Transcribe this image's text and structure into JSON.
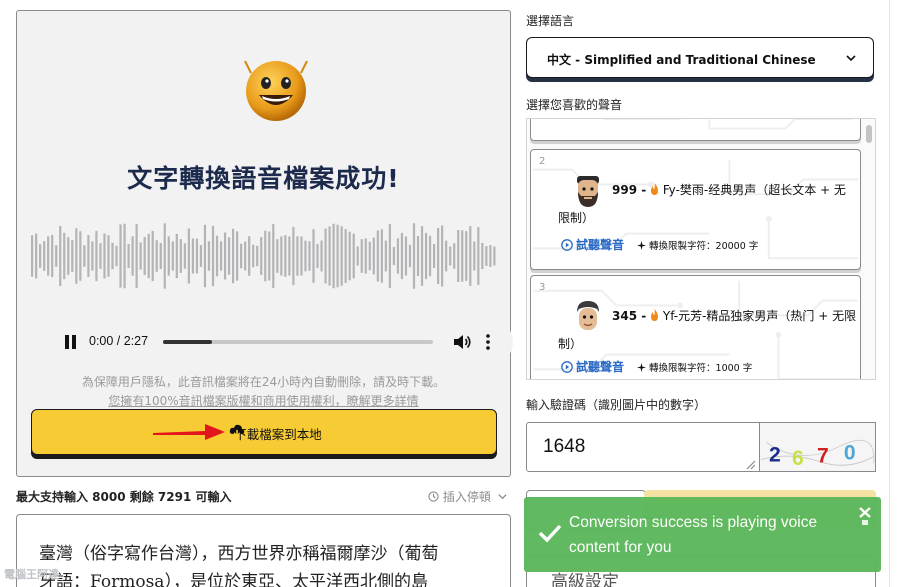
{
  "result": {
    "title": "文字轉換語音檔案成功!",
    "player": {
      "time": "0:00 / 2:27",
      "progress_fraction": 0.18
    },
    "privacy_line1": "為保障用戶隱私，此音訊檔案將在24小時內自動刪除，請及時下載。",
    "privacy_line2": "您擁有100%音訊檔案版權和商用使用權利，瞭解更多詳情",
    "download_label": "下載檔案到本地",
    "accent_color": "#f7cb33"
  },
  "editor": {
    "limit_text": "最大支持輸入 8000 剩餘 7291 可輸入",
    "insert_pause": "插入停頓",
    "text_line1": "臺灣（俗字寫作台灣），西方世界亦稱福爾摩沙（葡萄",
    "text_line2": "牙語：Formosa），是位於東亞、太平洋西北側的島"
  },
  "language": {
    "label": "選擇語言",
    "selected": "中文 - Simplified and Traditional Chinese"
  },
  "voices": {
    "label": "選擇您喜歡的聲音",
    "items": [
      {
        "index": "2",
        "id": "999 -",
        "name": "Fy-樊雨-经典男声（超长文本 + 无",
        "name_cont": "限制）",
        "listen": "試聽聲音",
        "limit": "轉換限製字符：20000 字"
      },
      {
        "index": "3",
        "id": "345 -",
        "name": "Yf-元芳-精品独家男声（热门 + 无限",
        "name_cont": "制）",
        "listen": "試聽聲音",
        "limit": "轉換限製字符：1000 字"
      }
    ]
  },
  "captcha": {
    "label": "輸入驗證碼（識別圖片中的數字）",
    "value": "1648",
    "image_digits": [
      "2",
      "6",
      "7",
      "0"
    ],
    "image_colors": [
      "#1b2e8c",
      "#c8e04a",
      "#d21f1f",
      "#4aa8d8"
    ]
  },
  "advanced": {
    "label": "高級設定"
  },
  "toast": {
    "message": "Conversion success is playing voice content for you",
    "color": "#5cb85c"
  },
  "watermark": "電腦王阿達"
}
